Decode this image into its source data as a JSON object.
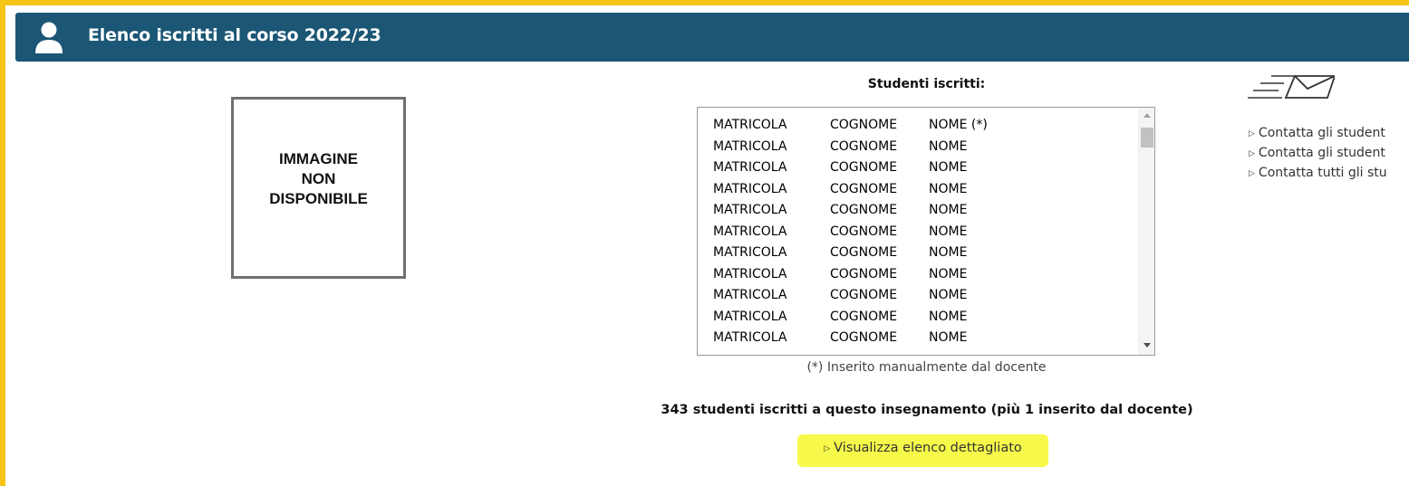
{
  "header": {
    "title": "Elenco iscritti al corso 2022/23",
    "icon": "user-icon",
    "background_color": "#1b5675"
  },
  "image_placeholder": {
    "text": "IMMAGINE\nNON\nDISPONIBILE"
  },
  "students": {
    "title": "Studenti iscritti:",
    "rows": [
      {
        "matricola": "MATRICOLA",
        "cognome": "COGNOME",
        "nome": "NOME (*)"
      },
      {
        "matricola": "MATRICOLA",
        "cognome": "COGNOME",
        "nome": "NOME"
      },
      {
        "matricola": "MATRICOLA",
        "cognome": "COGNOME",
        "nome": "NOME"
      },
      {
        "matricola": "MATRICOLA",
        "cognome": "COGNOME",
        "nome": "NOME"
      },
      {
        "matricola": "MATRICOLA",
        "cognome": "COGNOME",
        "nome": "NOME"
      },
      {
        "matricola": "MATRICOLA",
        "cognome": "COGNOME",
        "nome": "NOME"
      },
      {
        "matricola": "MATRICOLA",
        "cognome": "COGNOME",
        "nome": "NOME"
      },
      {
        "matricola": "MATRICOLA",
        "cognome": "COGNOME",
        "nome": "NOME"
      },
      {
        "matricola": "MATRICOLA",
        "cognome": "COGNOME",
        "nome": "NOME"
      },
      {
        "matricola": "MATRICOLA",
        "cognome": "COGNOME",
        "nome": "NOME"
      },
      {
        "matricola": "MATRICOLA",
        "cognome": "COGNOME",
        "nome": "NOME"
      }
    ],
    "footnote": "(*) Inserito manualmente dal docente",
    "count_text": "343 studenti iscritti a questo insegnamento (più 1 inserito dal docente)",
    "detail_link": "Visualizza elenco dettagliato",
    "highlight_color": "#f7f94a"
  },
  "contact": {
    "icon": "send-mail-icon",
    "items": [
      "Contatta gli student",
      "Contatta gli student",
      "Contatta tutti gli stu"
    ]
  },
  "colors": {
    "frame_border": "#f5c518"
  }
}
